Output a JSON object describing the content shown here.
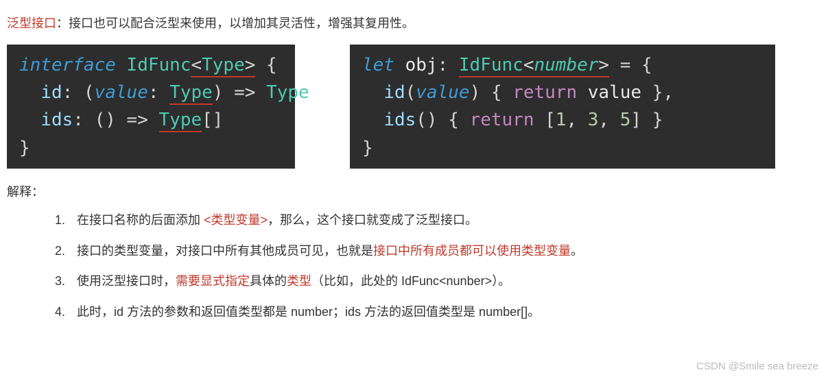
{
  "intro": {
    "term": "泛型接口",
    "body": "：接口也可以配合泛型来使用，以增加其灵活性，增强其复用性。"
  },
  "code_left": {
    "l1_interface": "interface",
    "l1_space": " ",
    "l1_name": "IdFunc",
    "l1_lt": "<",
    "l1_type": "Type",
    "l1_gt": ">",
    "l1_brace": " {",
    "l2_indent": "  ",
    "l2_id": "id",
    "l2_colon": ": (",
    "l2_value": "value",
    "l2_colon2": ": ",
    "l2_type": "Type",
    "l2_close_arrow": ") => ",
    "l2_ret": "Type",
    "l3_indent": "  ",
    "l3_ids": "ids",
    "l3_colon": ": () => ",
    "l3_type": "Type",
    "l3_brackets": "[]",
    "l4_close": "}"
  },
  "code_right": {
    "l1_let": "let",
    "l1_sp": " ",
    "l1_obj": "obj",
    "l1_colon": ": ",
    "l1_idfunc": "IdFunc",
    "l1_lt": "<",
    "l1_number": "number",
    "l1_gt": ">",
    "l1_eq_brace": " = {",
    "l2_indent": "  ",
    "l2_id": "id",
    "l2_open": "(",
    "l2_value": "value",
    "l2_close": ") { ",
    "l2_return": "return",
    "l2_sp": " ",
    "l2_val2": "value",
    "l2_end": " },",
    "l3_indent": "  ",
    "l3_ids": "ids",
    "l3_open": "() { ",
    "l3_return": "return",
    "l3_arr_open": " [",
    "l3_n1": "1",
    "l3_c1": ", ",
    "l3_n2": "3",
    "l3_c2": ", ",
    "l3_n3": "5",
    "l3_arr_close": "] }",
    "l4_close": "}"
  },
  "explain_heading": "解释：",
  "explain_list": [
    {
      "parts": [
        {
          "text": "在接口名称的后面添加 ",
          "red": false
        },
        {
          "text": "<类型变量>",
          "red": true
        },
        {
          "text": "，那么，这个接口就变成了泛型接口。",
          "red": false
        }
      ]
    },
    {
      "parts": [
        {
          "text": "接口的类型变量，对接口中所有其他成员可见，也就是",
          "red": false
        },
        {
          "text": "接口中所有成员都可以使用类型变量",
          "red": true
        },
        {
          "text": "。",
          "red": false
        }
      ]
    },
    {
      "parts": [
        {
          "text": "使用泛型接口时，",
          "red": false
        },
        {
          "text": "需要显式指定",
          "red": true
        },
        {
          "text": "具体的",
          "red": false
        },
        {
          "text": "类型",
          "red": true
        },
        {
          "text": "（比如，此处的 IdFunc<nunber>）。",
          "red": false
        }
      ]
    },
    {
      "parts": [
        {
          "text": "此时，id 方法的参数和返回值类型都是 number；ids 方法的返回值类型是 number[]。",
          "red": false
        }
      ]
    }
  ],
  "watermark": "CSDN @Smile sea breeze"
}
